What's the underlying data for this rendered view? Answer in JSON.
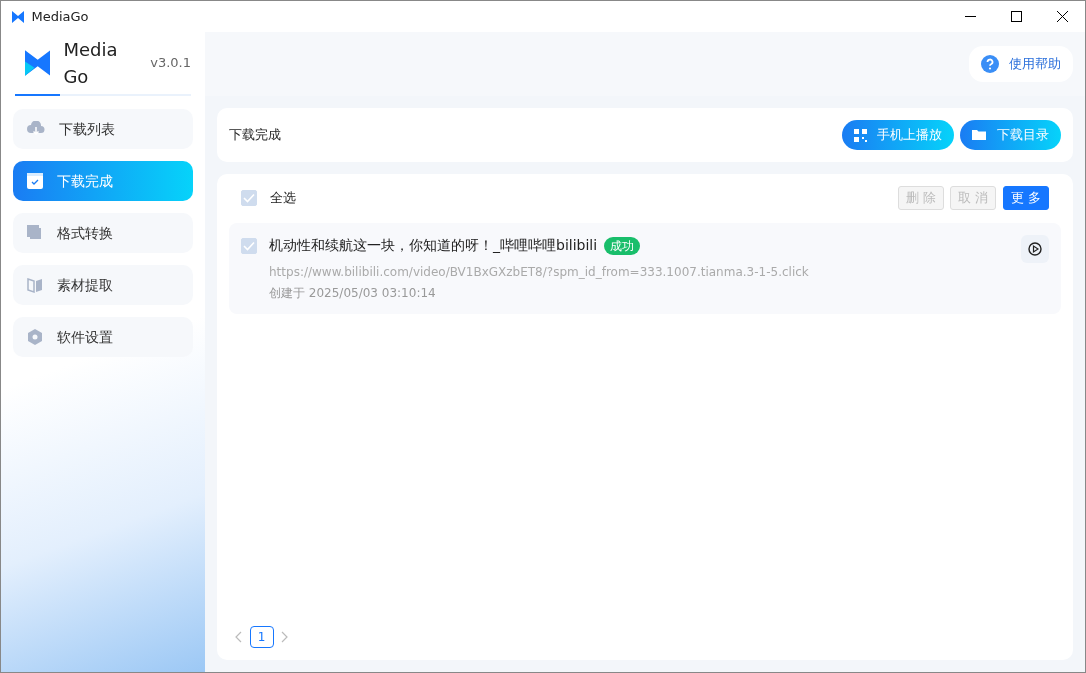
{
  "window": {
    "title": "MediaGo"
  },
  "app": {
    "name": "Media Go",
    "version": "v3.0.1",
    "help": "使用帮助"
  },
  "sidebar": {
    "items": [
      {
        "label": "下载列表",
        "selected": false,
        "kind": "cloud"
      },
      {
        "label": "下载完成",
        "selected": true,
        "kind": "done"
      },
      {
        "label": "格式转换",
        "selected": false,
        "kind": "convert"
      },
      {
        "label": "素材提取",
        "selected": false,
        "kind": "extract"
      },
      {
        "label": "软件设置",
        "selected": false,
        "kind": "settings"
      }
    ]
  },
  "main": {
    "title": "下载完成",
    "buttons": [
      {
        "label": "手机上播放",
        "kind": "qr"
      },
      {
        "label": "下载目录",
        "kind": "folder"
      }
    ]
  },
  "list": {
    "select_all": {
      "label": "全选",
      "checked": true
    },
    "actions": [
      {
        "label": "删 除",
        "disabled": true
      },
      {
        "label": "取 消",
        "disabled": true
      },
      {
        "label": "更 多",
        "disabled": false
      }
    ],
    "items": [
      {
        "title": "机动性和续航这一块，你知道的呀！_哔哩哔哩bilibili",
        "status": "成功",
        "url": "https://www.bilibili.com/video/BV1BxGXzbET8/?spm_id_from=333.1007.tianma.3-1-5.click",
        "created": "创建于 2025/05/03 03:10:14",
        "checked": true
      }
    ]
  },
  "pagination": {
    "pages": [
      {
        "label": "1",
        "selected": true
      }
    ]
  }
}
